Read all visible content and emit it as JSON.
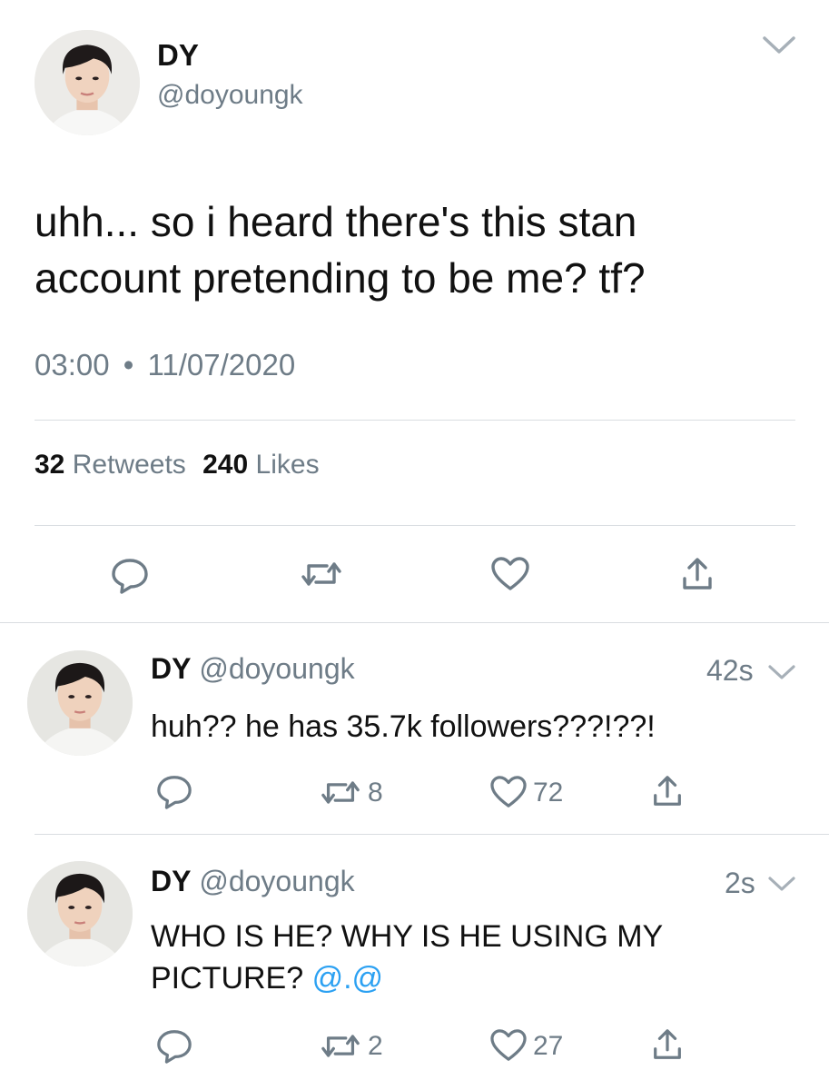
{
  "main_tweet": {
    "display_name": "DY",
    "handle": "@doyoungk",
    "text": "uhh... so i heard there's this stan account pretending to be me? tf?",
    "time": "03:00",
    "separator": "•",
    "date": "11/07/2020",
    "retweets_count": "32",
    "retweets_label": "Retweets",
    "likes_count": "240",
    "likes_label": "Likes"
  },
  "replies": [
    {
      "display_name": "DY",
      "handle": "@doyoungk",
      "age": "42s",
      "text": "huh?? he has 35.7k followers???!??!",
      "retweets": "8",
      "likes": "72"
    },
    {
      "display_name": "DY",
      "handle": "@doyoungk",
      "age": "2s",
      "text_before": "WHO IS HE? WHY IS HE USING MY PICTURE?",
      "mention": "@.@",
      "retweets": "2",
      "likes": "27"
    }
  ],
  "colors": {
    "text": "#111111",
    "muted": "#6e7c87",
    "link": "#2ca1f2",
    "divider": "#d9dde1"
  },
  "icons": [
    "chevron-down-icon",
    "reply-icon",
    "retweet-icon",
    "heart-icon",
    "share-icon"
  ]
}
